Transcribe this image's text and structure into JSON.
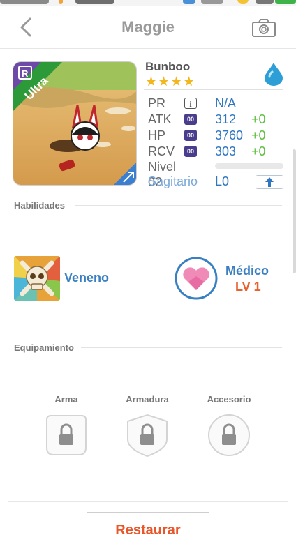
{
  "nav": {
    "title": "Maggie"
  },
  "monster": {
    "badge": "Ultra",
    "name": "Bunboo",
    "stars": "★★★★",
    "element": "water-drop-icon",
    "stats": [
      {
        "key": "PR",
        "icon": "i",
        "value": "N/A",
        "bonus": ""
      },
      {
        "key": "ATK",
        "icon": "00",
        "value": "312",
        "bonus": "+0"
      },
      {
        "key": "HP",
        "icon": "00",
        "value": "3760",
        "bonus": "+0"
      },
      {
        "key": "RCV",
        "icon": "00",
        "value": "303",
        "bonus": "+0"
      }
    ],
    "level_label": "Nivel 02",
    "level_progress": 0,
    "sign": "Sagitario",
    "skill_level": "L0"
  },
  "sections": {
    "skills": "Habilidades",
    "equipment": "Equipamiento"
  },
  "skill": {
    "name": "Veneno"
  },
  "perk": {
    "name": "Médico",
    "level": "LV 1"
  },
  "equipment": {
    "slots": [
      {
        "label": "Arma"
      },
      {
        "label": "Armadura"
      },
      {
        "label": "Accesorio"
      }
    ]
  },
  "footer": {
    "restore_label": "Restaurar"
  },
  "colors": {
    "accent_blue": "#2f77c0",
    "accent_orange": "#e8562a",
    "bonus_green": "#5bbf3c",
    "star_gold": "#f3b71e"
  }
}
